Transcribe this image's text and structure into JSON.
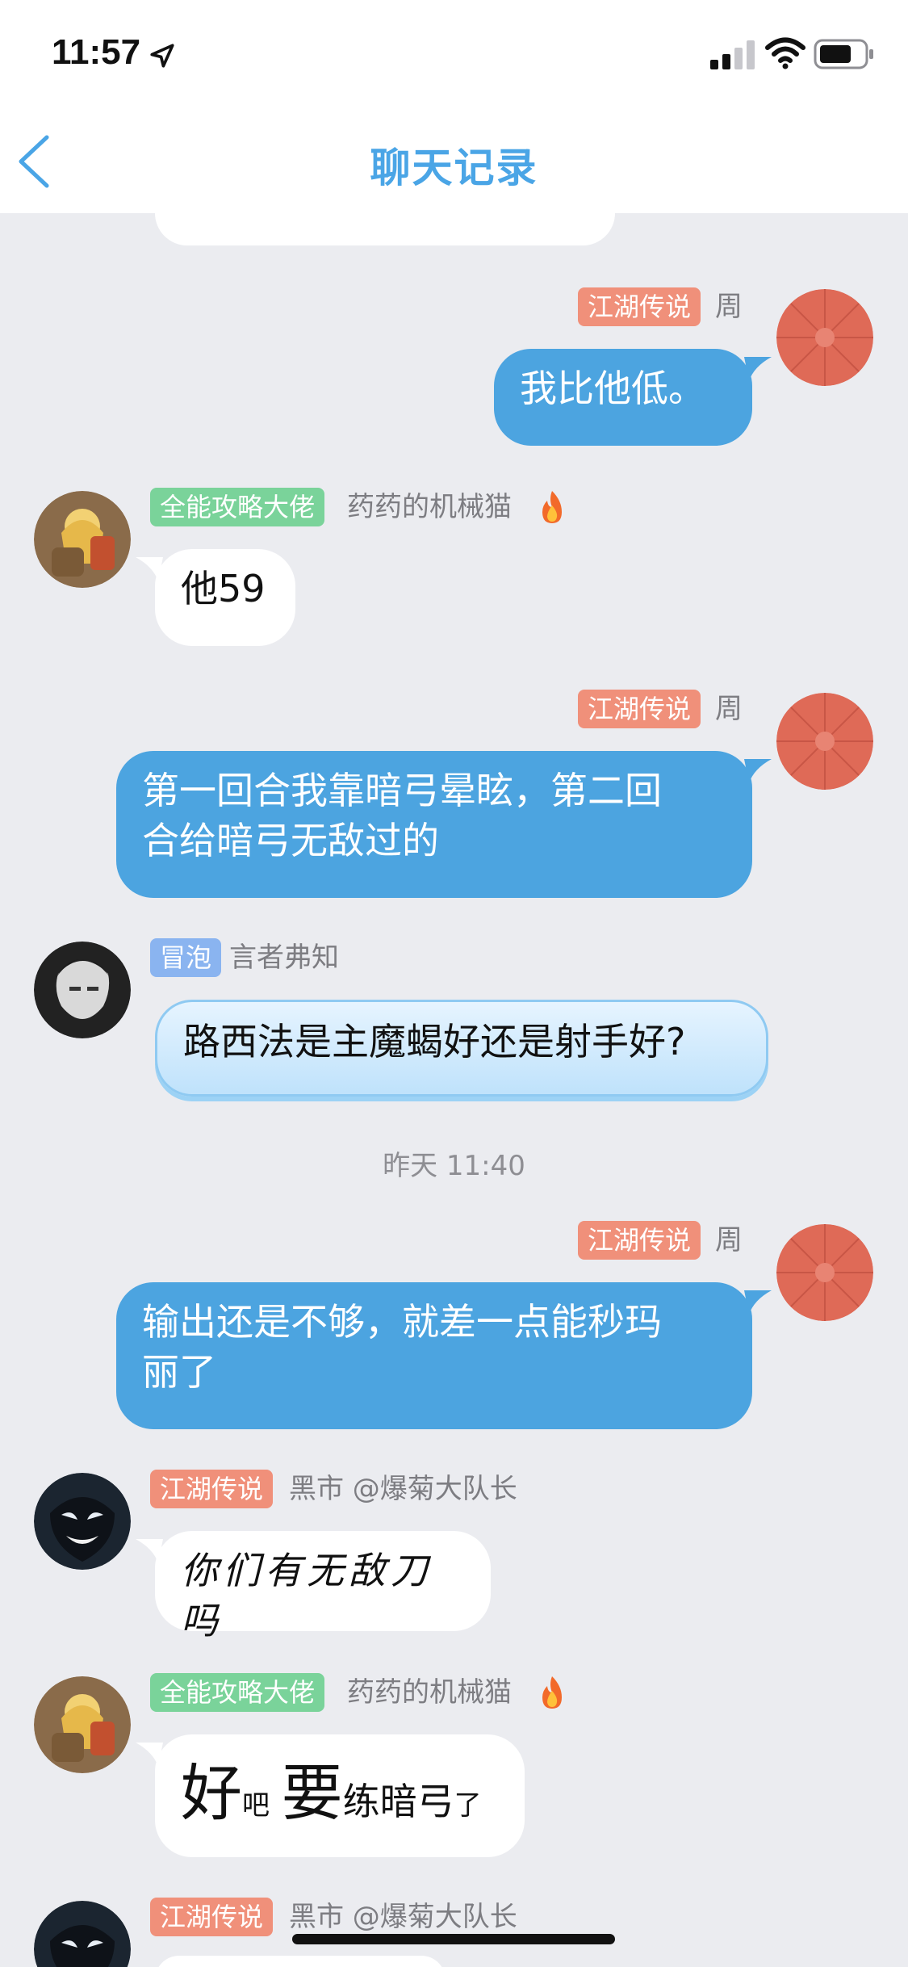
{
  "status_bar": {
    "time": "11:57"
  },
  "nav": {
    "title": "聊天记录",
    "back_icon": "chevron-left-icon"
  },
  "colors": {
    "accent": "#4aa5e6",
    "blue_bubble": "#4ca4e0",
    "tag_red": "#f0907a",
    "tag_green": "#7ad39a",
    "tag_blue": "#8ab4f0"
  },
  "messages": [
    {
      "side": "right",
      "tag": "江湖传说",
      "name": "周",
      "text": "我比他低。"
    },
    {
      "side": "left",
      "tag": "全能攻略大佬",
      "name": "药药的机械猫",
      "badge": "fire-icon",
      "text": "他59"
    },
    {
      "side": "right",
      "tag": "江湖传说",
      "name": "周",
      "text_line1": "第一回合我靠暗弓晕眩，第二回",
      "text_line2": "合给暗弓无敌过的"
    },
    {
      "side": "left",
      "tag": "冒泡",
      "name": "言者弗知",
      "text": "路西法是主魔蝎好还是射手好?"
    },
    {
      "timestamp": "昨天 11:40"
    },
    {
      "side": "right",
      "tag": "江湖传说",
      "name": "周",
      "text_line1": "输出还是不够，就差一点能秒玛",
      "text_line2": "丽了"
    },
    {
      "side": "left",
      "tag": "江湖传说",
      "name": "黑市 @爆菊大队长",
      "text": "你们有无敌刀吗"
    },
    {
      "side": "left",
      "tag": "全能攻略大佬",
      "name": "药药的机械猫",
      "badge": "fire-icon",
      "text_parts": [
        "好",
        "吧",
        "要",
        "练暗弓",
        "了"
      ]
    },
    {
      "side": "left",
      "tag": "江湖传说",
      "name": "黑市 @爆菊大队长"
    }
  ]
}
